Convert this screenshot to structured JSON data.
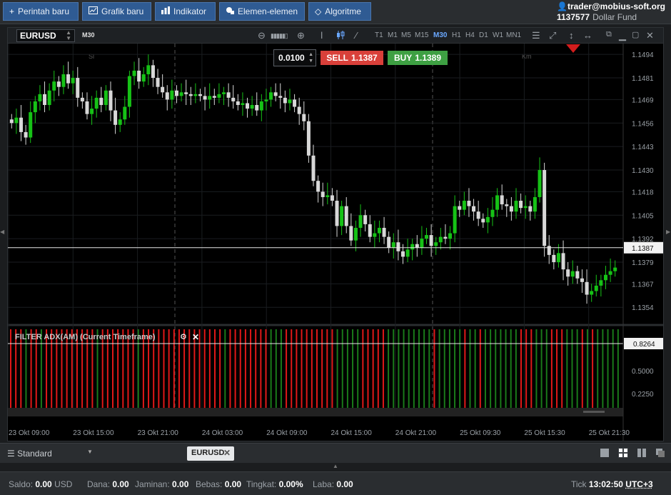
{
  "toolbar": {
    "buttons": [
      {
        "label": "Perintah baru",
        "icon": "+"
      },
      {
        "label": "Grafik baru",
        "icon": "chart-icon"
      },
      {
        "label": "Indikator",
        "icon": "bars-icon"
      },
      {
        "label": "Elemen-elemen",
        "icon": "shapes-icon"
      },
      {
        "label": "Algoritme",
        "icon": "diamond-icon"
      }
    ]
  },
  "account": {
    "user": "trader@mobius-soft.org",
    "id": "1137577",
    "fund": "Dollar Fund"
  },
  "chart": {
    "symbol": "EURUSD",
    "timeframe_label": "M30",
    "timeframes": [
      "T1",
      "M1",
      "M5",
      "M15",
      "M30",
      "H1",
      "H4",
      "D1",
      "W1",
      "MN1"
    ],
    "active_timeframe": "M30",
    "session_labels": [
      "Sl",
      "Km"
    ],
    "order": {
      "lot": "0.0100",
      "sell_label": "SELL",
      "sell_price": "1.1387",
      "buy_label": "BUY",
      "buy_price": "1.1389"
    },
    "indicator_title": "FILTER ADX(AM) (Current Timeframe)",
    "colors": {
      "up": "#16c216",
      "down": "#d8d8d8",
      "bar_red": "#e01818",
      "bar_green": "#1a7a1a",
      "sell": "#d9403a",
      "buy": "#3ea043"
    }
  },
  "chart_data": {
    "type": "candlestick",
    "price_ticks": [
      "1.1494",
      "1.1481",
      "1.1469",
      "1.1456",
      "1.1443",
      "1.1430",
      "1.1418",
      "1.1405",
      "1.1392",
      "1.1379",
      "1.1367",
      "1.1354"
    ],
    "current_price": "1.1387",
    "indicator_ticks": [
      "0.5000",
      "0.2250"
    ],
    "indicator_value": "0.8264",
    "x_labels": [
      "23 Okt 09:00",
      "23 Okt 15:00",
      "23 Okt 21:00",
      "24 Okt 03:00",
      "24 Okt 09:00",
      "24 Okt 15:00",
      "24 Okt 21:00",
      "25 Okt 09:30",
      "25 Okt 15:30",
      "25 Okt 21:30"
    ],
    "close": [
      1.1456,
      1.1459,
      1.1451,
      1.1448,
      1.1462,
      1.1468,
      1.1472,
      1.1466,
      1.1474,
      1.1479,
      1.1476,
      1.1483,
      1.1478,
      1.1481,
      1.147,
      1.1468,
      1.1461,
      1.1464,
      1.147,
      1.1466,
      1.1474,
      1.1463,
      1.1455,
      1.1458,
      1.1465,
      1.1482,
      1.1485,
      1.1479,
      1.1483,
      1.1488,
      1.1481,
      1.1476,
      1.1473,
      1.1469,
      1.1474,
      1.1471,
      1.1473,
      1.1472,
      1.1471,
      1.1472,
      1.1471,
      1.1469,
      1.1471,
      1.147,
      1.1472,
      1.1473,
      1.147,
      1.1468,
      1.1466,
      1.1467,
      1.1464,
      1.1466,
      1.1463,
      1.1468,
      1.1469,
      1.1473,
      1.1471,
      1.147,
      1.1467,
      1.1469,
      1.1465,
      1.1461,
      1.1457,
      1.1438,
      1.1424,
      1.1418,
      1.1415,
      1.1416,
      1.1413,
      1.1399,
      1.141,
      1.1399,
      1.1391,
      1.1398,
      1.1405,
      1.14,
      1.1393,
      1.1395,
      1.1398,
      1.1393,
      1.1387,
      1.139,
      1.1385,
      1.1382,
      1.1386,
      1.1389,
      1.1387,
      1.1392,
      1.1394,
      1.1388,
      1.139,
      1.1393,
      1.1392,
      1.1395,
      1.141,
      1.1408,
      1.1413,
      1.141,
      1.1407,
      1.1403,
      1.1401,
      1.1404,
      1.1408,
      1.1416,
      1.1411,
      1.141,
      1.1407,
      1.1413,
      1.1409,
      1.141,
      1.1407,
      1.1415,
      1.143,
      1.1388,
      1.1383,
      1.1379,
      1.1384,
      1.1375,
      1.1371,
      1.1374,
      1.137,
      1.1368,
      1.1361,
      1.1363,
      1.1366,
      1.1369,
      1.1372,
      1.1374,
      1.1376
    ],
    "indicator_bars": "rrrgrrgrrrrrrrrrrgrrrrrrrgrrrrrrrrrrrrrrrrgrrrrrrrrgggrrrrrrrrrrgggggrrrrrgggggggggrgggggrggrgggggggrrrgggrrrgggrgrggggg"
  }
}
